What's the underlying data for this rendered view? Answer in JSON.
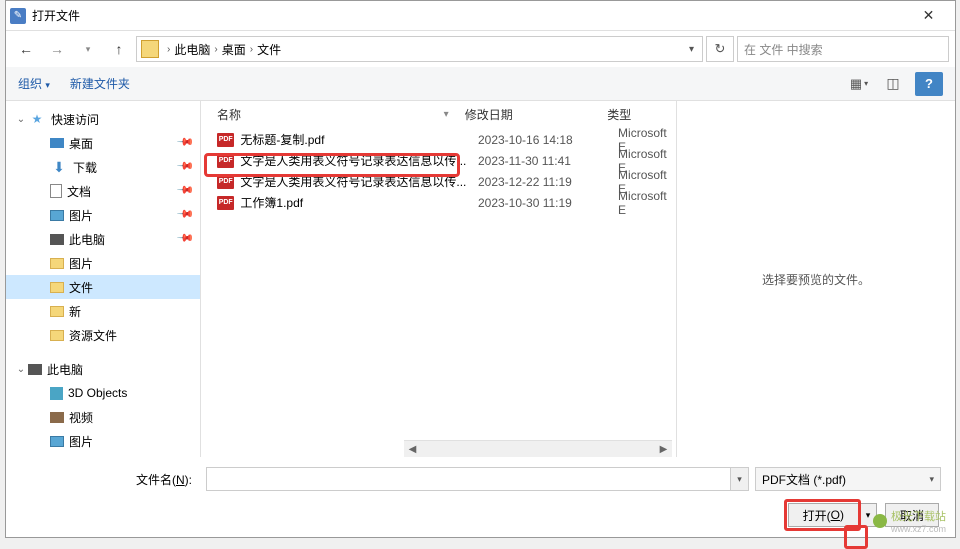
{
  "title": "打开文件",
  "nav": {
    "back": "←",
    "fwd": "→",
    "up": "↑"
  },
  "breadcrumb": [
    "此电脑",
    "桌面",
    "文件"
  ],
  "search": {
    "placeholder": "在 文件 中搜索"
  },
  "toolbar": {
    "organize": "组织",
    "dropdown": "▾",
    "newfolder": "新建文件夹",
    "view": "▤▾",
    "preview": "◫",
    "help": "?"
  },
  "tree": {
    "groups": [
      {
        "label": "快速访问",
        "icon": "star",
        "expanded": true,
        "children": [
          {
            "label": "桌面",
            "icon": "desktop",
            "pinned": true
          },
          {
            "label": "下载",
            "icon": "download",
            "pinned": true
          },
          {
            "label": "文档",
            "icon": "doc",
            "pinned": true
          },
          {
            "label": "图片",
            "icon": "pic",
            "pinned": true
          },
          {
            "label": "此电脑",
            "icon": "pc",
            "pinned": true
          },
          {
            "label": "图片",
            "icon": "folder"
          },
          {
            "label": "文件",
            "icon": "folder",
            "selected": true
          },
          {
            "label": "新",
            "icon": "folder"
          },
          {
            "label": "资源文件",
            "icon": "folder"
          }
        ]
      },
      {
        "label": "此电脑",
        "icon": "pc",
        "expanded": true,
        "children": [
          {
            "label": "3D Objects",
            "icon": "3d"
          },
          {
            "label": "视频",
            "icon": "video"
          },
          {
            "label": "图片",
            "icon": "pic"
          }
        ]
      }
    ]
  },
  "columns": {
    "name": "名称",
    "date": "修改日期",
    "type": "类型"
  },
  "files": [
    {
      "name": "无标题-复制.pdf",
      "date": "2023-10-16 14:18",
      "type": "Microsoft E"
    },
    {
      "name": "文字是人类用表义符号记录表达信息以传...",
      "date": "2023-11-30 11:41",
      "type": "Microsoft E",
      "hl": true
    },
    {
      "name": "文字是人类用表义符号记录表达信息以传...",
      "date": "2023-12-22 11:19",
      "type": "Microsoft E"
    },
    {
      "name": "工作簿1.pdf",
      "date": "2023-10-30 11:19",
      "type": "Microsoft E"
    }
  ],
  "preview_empty": "选择要预览的文件。",
  "footer": {
    "fname_label_pre": "文件名(",
    "fname_label_key": "N",
    "fname_label_post": "):",
    "filter": "PDF文档 (*.pdf)",
    "open_pre": "打开(",
    "open_key": "O",
    "open_post": ")",
    "cancel": "取消"
  },
  "watermark": {
    "name": "极光下载站",
    "url": "www.xz7.com"
  }
}
